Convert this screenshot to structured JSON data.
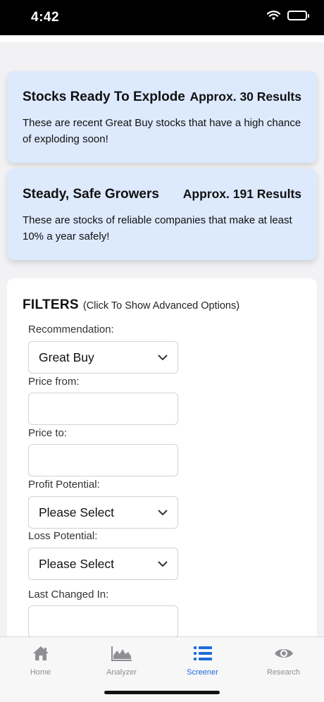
{
  "status_bar": {
    "time": "4:42"
  },
  "cards": [
    {
      "title": "Stocks Ready To Explode",
      "count": "Approx. 30 Results",
      "description": "These are recent Great Buy stocks that have a high chance of exploding soon!"
    },
    {
      "title": "Steady, Safe Growers",
      "count": "Approx. 191 Results",
      "description": "These are stocks of reliable companies that make at least 10% a year safely!"
    }
  ],
  "filters": {
    "title": "FILTERS",
    "hint": "(Click To Show Advanced Options)",
    "fields": {
      "recommendation": {
        "label": "Recommendation:",
        "value": "Great Buy"
      },
      "price_from": {
        "label": "Price from:",
        "value": ""
      },
      "price_to": {
        "label": "Price to:",
        "value": ""
      },
      "profit_potential": {
        "label": "Profit Potential:",
        "value": "Please Select"
      },
      "loss_potential": {
        "label": "Loss Potential:",
        "value": "Please Select"
      },
      "last_changed_in": {
        "label": "Last Changed In:",
        "value": ""
      }
    }
  },
  "tabs": [
    {
      "label": "Home",
      "icon": "home-icon",
      "active": false
    },
    {
      "label": "Analyzer",
      "icon": "area-chart-icon",
      "active": false
    },
    {
      "label": "Screener",
      "icon": "list-icon",
      "active": true
    },
    {
      "label": "Research",
      "icon": "eye-icon",
      "active": false
    }
  ],
  "colors": {
    "card_background": "#dde9fd",
    "active_tab": "#1e6bd8",
    "inactive_tab": "#8e8e93"
  }
}
